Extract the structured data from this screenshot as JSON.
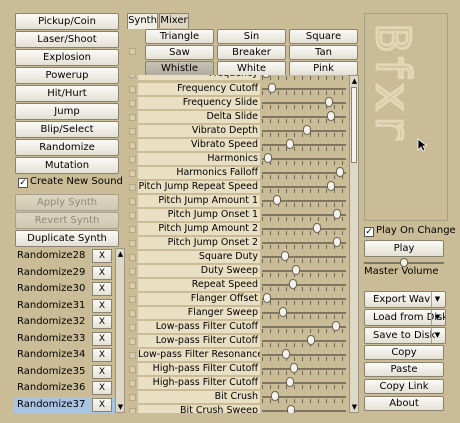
{
  "generator_buttons": [
    "Pickup/Coin",
    "Laser/Shoot",
    "Explosion",
    "Powerup",
    "Hit/Hurt",
    "Jump",
    "Blip/Select",
    "Randomize",
    "Mutation"
  ],
  "create_new_sound": {
    "label": "Create New Sound",
    "checked": true
  },
  "synth_actions": [
    {
      "label": "Apply Synth",
      "enabled": false
    },
    {
      "label": "Revert Synth",
      "enabled": false
    },
    {
      "label": "Duplicate Synth",
      "enabled": true
    }
  ],
  "tabs": [
    "Synth",
    "Mixer"
  ],
  "active_tab": "Synth",
  "waveforms": [
    "Triangle",
    "Sin",
    "Square",
    "Saw",
    "Breaker",
    "Tan",
    "Whistle",
    "White",
    "Pink"
  ],
  "selected_waveform": "Whistle",
  "params_partial_top": "Frequency",
  "params": [
    {
      "name": "Frequency Cutoff",
      "value": 0.08
    },
    {
      "name": "Frequency Slide",
      "value": 0.83
    },
    {
      "name": "Delta Slide",
      "value": 0.86
    },
    {
      "name": "Vibrato Depth",
      "value": 0.54
    },
    {
      "name": "Vibrato Speed",
      "value": 0.32
    },
    {
      "name": "Harmonics",
      "value": 0.02
    },
    {
      "name": "Harmonics Falloff",
      "value": 0.97
    },
    {
      "name": "Pitch Jump Repeat Speed",
      "value": 0.85
    },
    {
      "name": "Pitch Jump Amount 1",
      "value": 0.15
    },
    {
      "name": "Pitch Jump Onset 1",
      "value": 0.93
    },
    {
      "name": "Pitch Jump Amount 2",
      "value": 0.67
    },
    {
      "name": "Pitch Jump Onset 2",
      "value": 0.93
    },
    {
      "name": "Square Duty",
      "value": 0.25
    },
    {
      "name": "Duty Sweep",
      "value": 0.4
    },
    {
      "name": "Repeat Speed",
      "value": 0.35
    },
    {
      "name": "Flanger Offset",
      "value": 0.01
    },
    {
      "name": "Flanger Sweep",
      "value": 0.22
    },
    {
      "name": "Low-pass Filter Cutoff",
      "value": 0.92
    },
    {
      "name": "Low-pass Filter Cutoff",
      "value": 0.59
    },
    {
      "name": "Low-pass Filter Resonance",
      "value": 0.26
    },
    {
      "name": "High-pass Filter Cutoff",
      "value": 0.37
    },
    {
      "name": "High-pass Filter Cutoff",
      "value": 0.31
    },
    {
      "name": "Bit Crush",
      "value": 0.12
    },
    {
      "name": "Bit Crush Sweep",
      "value": 0.33
    }
  ],
  "slots": [
    {
      "name": "Randomize28",
      "selected": false
    },
    {
      "name": "Randomize29",
      "selected": false
    },
    {
      "name": "Randomize30",
      "selected": false
    },
    {
      "name": "Randomize31",
      "selected": false
    },
    {
      "name": "Randomize32",
      "selected": false
    },
    {
      "name": "Randomize33",
      "selected": false
    },
    {
      "name": "Randomize34",
      "selected": false
    },
    {
      "name": "Randomize35",
      "selected": false
    },
    {
      "name": "Randomize36",
      "selected": false
    },
    {
      "name": "Randomize37",
      "selected": true
    }
  ],
  "slot_delete_label": "X",
  "logo_text": "Bfxr",
  "play_on_change": {
    "label": "Play On Change",
    "checked": true
  },
  "play_label": "Play",
  "master_volume": {
    "label": "Master Volume",
    "value": 0.5
  },
  "file_dropdowns": [
    "Export Wav",
    "Load from Disk",
    "Save to Disk"
  ],
  "clipboard_buttons": [
    "Copy",
    "Paste",
    "Copy Link",
    "About"
  ],
  "colors": {
    "background": "#c9bc96",
    "param_label_bg": "#e9dfc2",
    "selected_slot": "#a9c3e3",
    "logo": "#e2d8b7"
  }
}
